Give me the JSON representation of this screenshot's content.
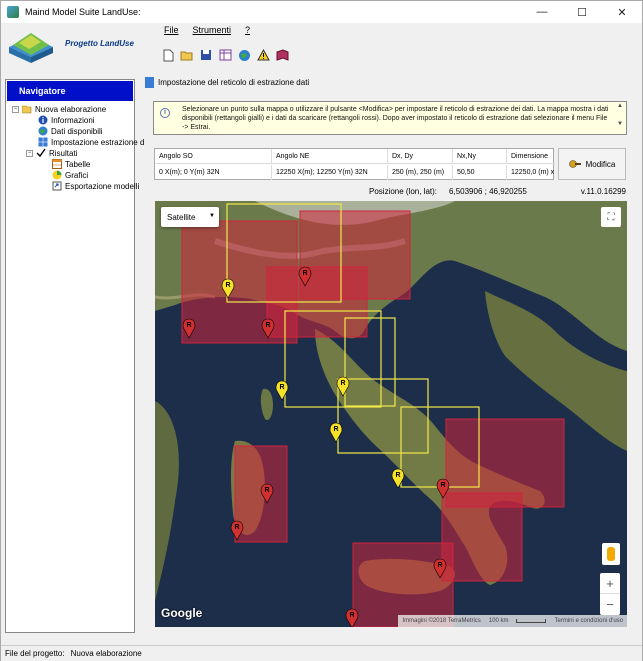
{
  "window": {
    "title": "Maind Model Suite LandUse:",
    "minimize_glyph": "—",
    "maximize_glyph": "☐",
    "close_glyph": "✕"
  },
  "header": {
    "project_label": "Progetto LandUse",
    "menu": [
      "File",
      "Strumenti",
      "?"
    ],
    "toolbar_icons": [
      "new-file-icon",
      "open-folder-icon",
      "save-icon",
      "grid-icon",
      "globe-icon",
      "warning-icon",
      "book-icon"
    ]
  },
  "navigator": {
    "title": "Navigatore",
    "items": [
      {
        "label": "Nuova elaborazione",
        "icon": "folder-open-icon",
        "level": 0,
        "expander": "−"
      },
      {
        "label": "Informazioni",
        "icon": "info-icon",
        "level": 1
      },
      {
        "label": "Dati disponibili",
        "icon": "globe-icon",
        "level": 1
      },
      {
        "label": "Impostazione estrazione d",
        "icon": "grid-settings-icon",
        "level": 1
      },
      {
        "label": "Risultati",
        "icon": "checkmark-icon",
        "level": 1,
        "expander": "−"
      },
      {
        "label": "Tabelle",
        "icon": "table-icon",
        "level": 2
      },
      {
        "label": "Grafici",
        "icon": "chart-icon",
        "level": 2
      },
      {
        "label": "Esportazione modelli",
        "icon": "export-icon",
        "level": 2
      }
    ]
  },
  "section": {
    "title": "Impostazione del reticolo di estrazione  dati",
    "info_text": "Selezionare un punto sulla mappa o utilizzare il pulsante <Modifica> per impostare il reticolo di estrazione dei dati. La mappa mostra i dati disponibili (rettangoli gialli) e i dati da scaricare (rettangoli rossi). Dopo aver impostato il reticolo di estrazione dati selezionare il menu File -> Estrai.",
    "scroll_up": "▲",
    "scroll_down": "▼"
  },
  "grid_table": {
    "headers": [
      "Angolo SO",
      "Angolo NE",
      "Dx, Dy",
      "Nx,Ny",
      "Dimensione"
    ],
    "row": [
      "0 X(m); 0 Y(m) 32N",
      "12250 X(m); 12250 Y(m) 32N",
      "250 (m), 250 (m)",
      "50,50",
      "12250,0 (m) x"
    ]
  },
  "modify_button": "Modifica",
  "position": {
    "label": "Posizione (lon, lat):",
    "value": "6,503906 ; 46,920255"
  },
  "version": "v.11.0.16299",
  "map": {
    "type_selector": "Satellite",
    "google_label": "Google",
    "attribution": "Immagini ©2018 TerraMetrics",
    "scale_label": "100 km",
    "terms": "Termini e condizioni d'uso",
    "zoom_in": "+",
    "zoom_out": "−",
    "fullscreen": "⛶",
    "marker_letter": "R",
    "colors": {
      "available_rect": "#f2e84a",
      "download_rect": "#d0243c",
      "sea": "#1c2e4a",
      "land": "#6b7a4a"
    }
  },
  "status": {
    "label": "File del progetto:",
    "value": "Nuova elaborazione"
  }
}
